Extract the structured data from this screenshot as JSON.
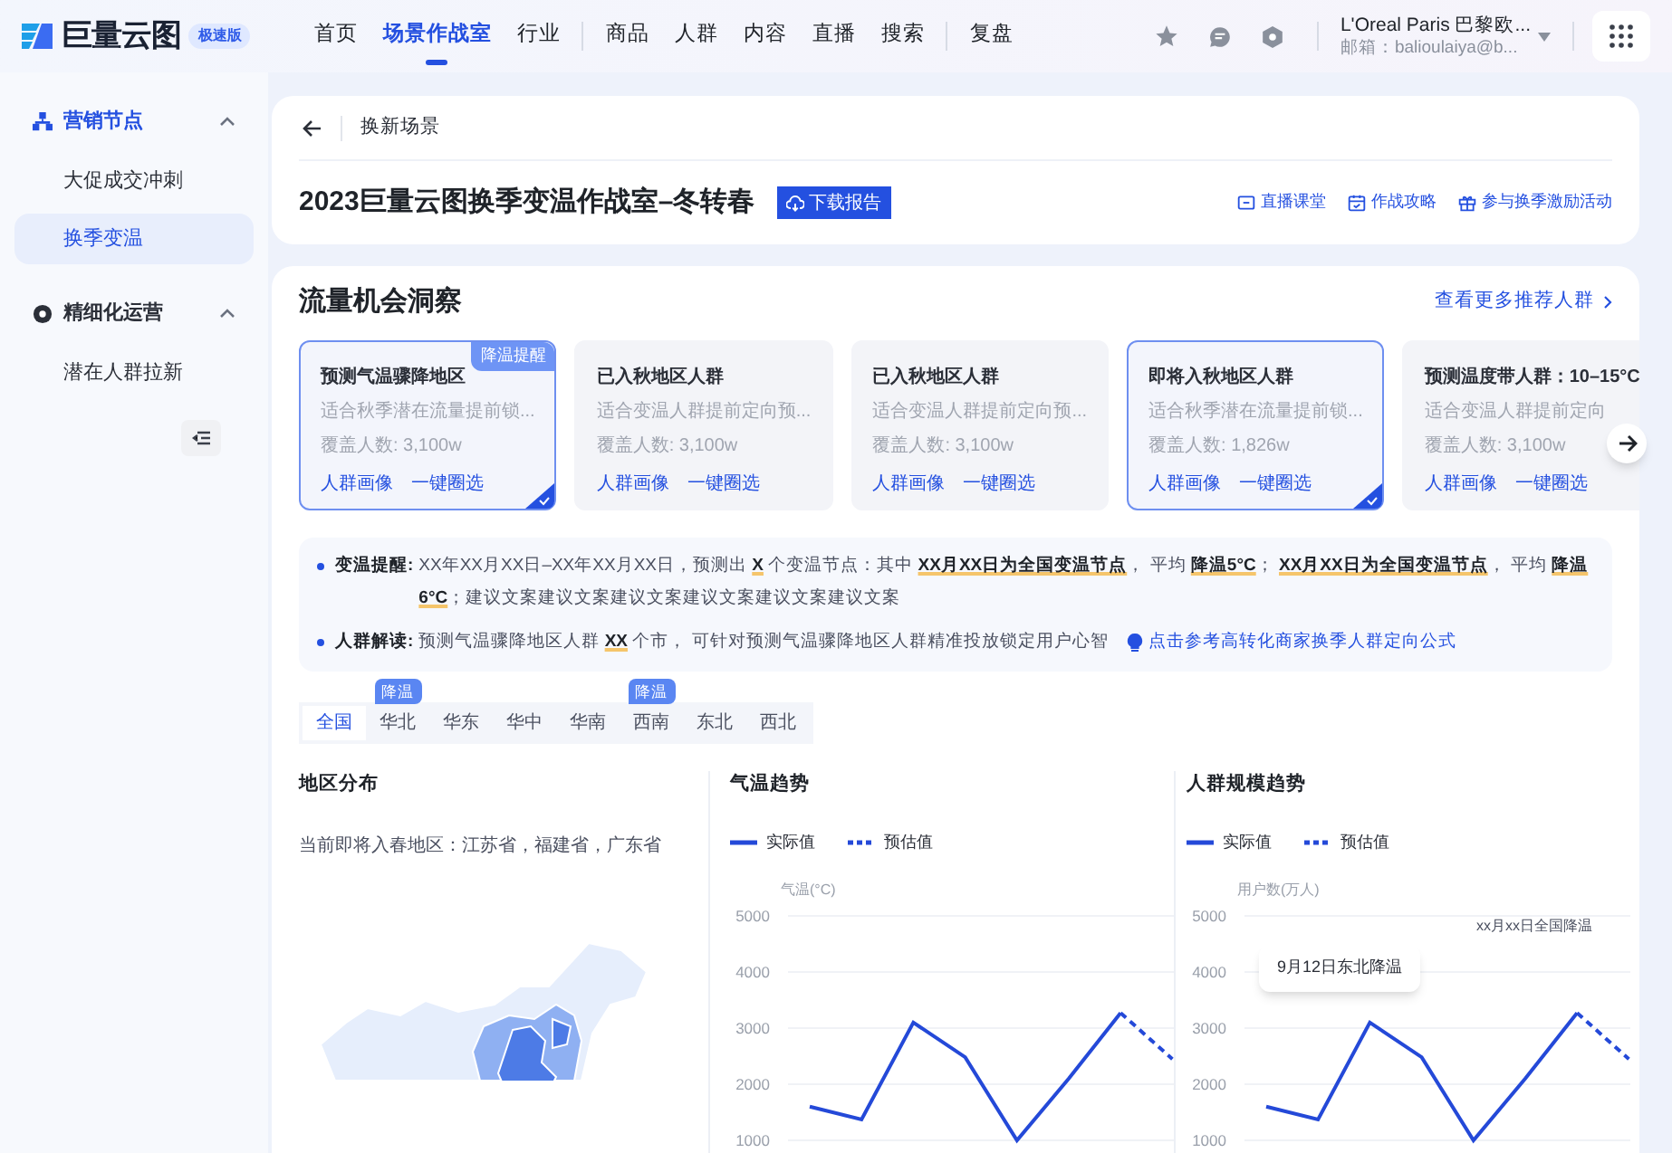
{
  "header": {
    "logo": {
      "name": "巨量云图",
      "badge": "极速版"
    },
    "nav_groups": [
      [
        {
          "label": "首页",
          "selected": false
        },
        {
          "label": "场景作战室",
          "selected": true
        },
        {
          "label": "行业",
          "selected": false
        }
      ],
      [
        {
          "label": "商品",
          "selected": false
        },
        {
          "label": "人群",
          "selected": false
        },
        {
          "label": "内容",
          "selected": false
        },
        {
          "label": "直播",
          "selected": false
        },
        {
          "label": "搜索",
          "selected": false
        }
      ],
      [
        {
          "label": "复盘",
          "selected": false
        }
      ]
    ],
    "account": {
      "name": "L'Oreal Paris 巴黎欧...",
      "email": "邮箱：balioulaiya@b..."
    }
  },
  "sidebar": {
    "groups": [
      {
        "label": "营销节点",
        "expanded": true,
        "children": [
          {
            "label": "大促成交冲刺",
            "selected": false
          },
          {
            "label": "换季变温",
            "selected": true
          }
        ]
      },
      {
        "label": "精细化运营",
        "expanded": true,
        "children": [
          {
            "label": "潜在人群拉新",
            "selected": false
          }
        ]
      }
    ]
  },
  "breadcrumb": "换新场景",
  "page_title": "2023巨量云图换季变温作战室–冬转春",
  "download_button": "下载报告",
  "header_links": [
    "直播课堂",
    "作战攻略",
    "参与换季激励活动"
  ],
  "insight": {
    "title": "流量机会洞察",
    "more_link": "查看更多推荐人群",
    "cards": [
      {
        "title": "预测气温骤降地区",
        "desc": "适合秋季潜在流量提前锁...",
        "coverage": "覆盖人数: 3,100w",
        "links": [
          "人群画像",
          "一键圈选"
        ],
        "tag": "降温提醒",
        "selected": true
      },
      {
        "title": "已入秋地区人群",
        "desc": "适合变温人群提前定向预...",
        "coverage": "覆盖人数: 3,100w",
        "links": [
          "人群画像",
          "一键圈选"
        ],
        "selected": false
      },
      {
        "title": "已入秋地区人群",
        "desc": "适合变温人群提前定向预...",
        "coverage": "覆盖人数: 3,100w",
        "links": [
          "人群画像",
          "一键圈选"
        ],
        "selected": false
      },
      {
        "title": "即将入秋地区人群",
        "desc": "适合秋季潜在流量提前锁...",
        "coverage": "覆盖人数: 1,826w",
        "links": [
          "人群画像",
          "一键圈选"
        ],
        "selected": true
      },
      {
        "title": "预测温度带人群：10–15°C",
        "desc": "适合变温人群提前定向",
        "coverage": "覆盖人数: 3,100w",
        "links": [
          "人群画像",
          "一键圈选"
        ],
        "selected": false
      }
    ],
    "notes": [
      {
        "label": "变温提醒:",
        "text": "XX年XX月XX日–XX年XX月XX日，预测出 **X** 个变温节点：其中 **XX月XX日为全国变温节点**， 平均 **降温5°C**； **XX月XX日为全国变温节点**， 平均 **降温6°C**；建议文案建议文案建议文案建议文案建议文案建议文案"
      },
      {
        "label": "人群解读:",
        "text": "预测气温骤降地区人群 **XX** 个市， 可针对预测气温骤降地区人群精准投放锁定用户心智",
        "link": "点击参考高转化商家换季人群定向公式"
      }
    ],
    "regions": [
      {
        "label": "全国",
        "selected": true
      },
      {
        "label": "华北",
        "selected": false,
        "badge": "降温"
      },
      {
        "label": "华东",
        "selected": false
      },
      {
        "label": "华中",
        "selected": false
      },
      {
        "label": "华南",
        "selected": false
      },
      {
        "label": "西南",
        "selected": false,
        "badge": "降温"
      },
      {
        "label": "东北",
        "selected": false
      },
      {
        "label": "西北",
        "selected": false
      }
    ]
  },
  "region_panel": {
    "title": "地区分布",
    "summary": "当前即将入春地区：江苏省，福建省，广东省"
  },
  "temperature_trend": {
    "chart_data": {
      "type": "line",
      "title": "气温趋势",
      "ylabel": "气温(°C)",
      "ylim": [
        1000,
        5000
      ],
      "yticks": [
        1000,
        2000,
        3000,
        4000,
        5000
      ],
      "grid": true,
      "series": [
        {
          "name": "实际值",
          "color": "#2449d8",
          "line_style": "solid",
          "values": [
            1600,
            1370,
            3100,
            2480,
            1000,
            2100,
            3270,
            null
          ]
        },
        {
          "name": "预估值",
          "color": "#2449d8",
          "line_style": "dashed",
          "values": [
            null,
            null,
            null,
            null,
            null,
            null,
            3270,
            2450
          ]
        }
      ]
    }
  },
  "crowd_trend": {
    "chart_data": {
      "type": "line",
      "title": "人群规模趋势",
      "ylabel": "用户数(万人)",
      "ylim": [
        1000,
        5000
      ],
      "yticks": [
        1000,
        2000,
        3000,
        4000,
        5000
      ],
      "grid": true,
      "series": [
        {
          "name": "实际值",
          "color": "#2449d8",
          "line_style": "solid",
          "values": [
            1600,
            1370,
            3100,
            2480,
            1000,
            2100,
            3270,
            null
          ]
        },
        {
          "name": "预估值",
          "color": "#2449d8",
          "line_style": "dashed",
          "values": [
            null,
            null,
            null,
            null,
            null,
            null,
            3270,
            2450
          ]
        }
      ],
      "annotations": [
        {
          "text": "xx月xx日全国降温"
        },
        {
          "text": "9月12日东北降温"
        }
      ]
    }
  }
}
